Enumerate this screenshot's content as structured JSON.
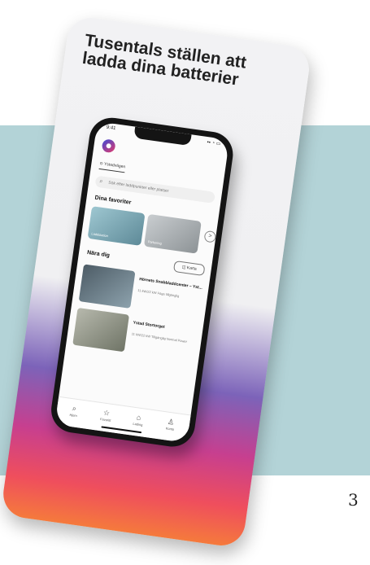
{
  "page_number": "3",
  "card": {
    "title": "Tusentals ställen att ladda dina batterier"
  },
  "app": {
    "status_time": "9:41",
    "status_icons": "▪▪ ◔ ▭",
    "location_label": "Ystadvägen",
    "search_placeholder": "Sök efter laddpunkter eller platser",
    "favorites_title": "Dina favoriter",
    "favorites": [
      {
        "caption": "Laddstation"
      },
      {
        "caption": "Parkering"
      }
    ],
    "more_label": ">",
    "nearby_title": "Nära dig",
    "map_button": "Karta",
    "nearby": [
      {
        "name": "Hörnets Snabbladdcenter – Yst...",
        "meta": "11 kW/22 kW\nFöga tillgänglig"
      },
      {
        "name": "Ystad Stortorget",
        "meta": "11 kW/22 kW\nTillgänglig\nNormal Power"
      }
    ],
    "nav": [
      {
        "label": "Hjem",
        "icon": "⌕"
      },
      {
        "label": "Favoritt",
        "icon": "☆"
      },
      {
        "label": "Lading",
        "icon": "⌂"
      },
      {
        "label": "Konto",
        "icon": "♙"
      }
    ]
  }
}
